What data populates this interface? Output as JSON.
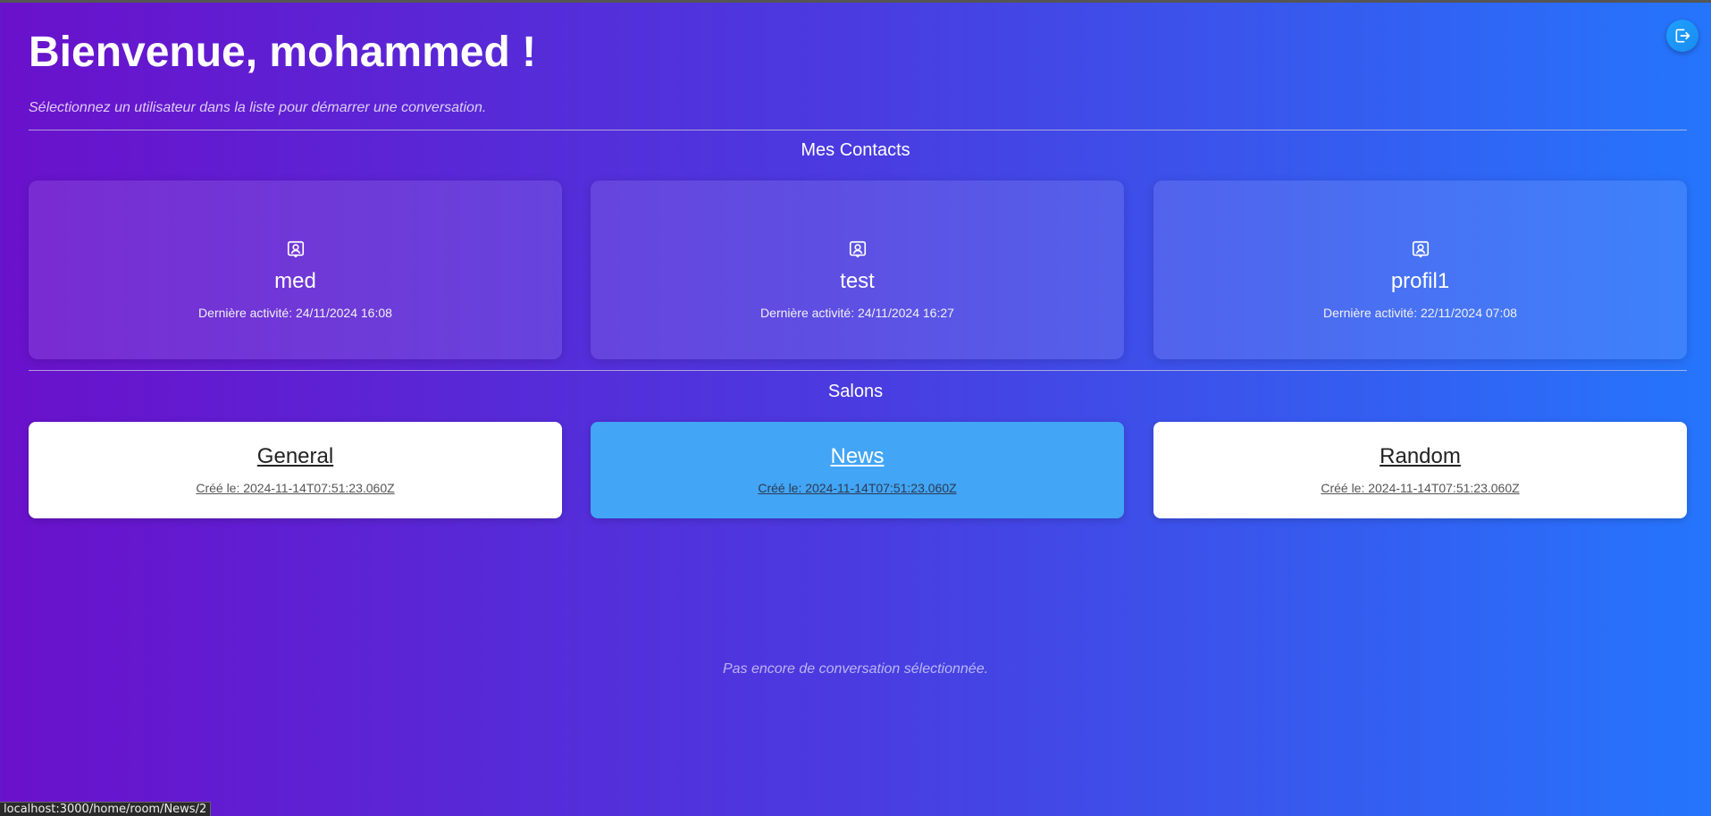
{
  "header": {
    "title": "Bienvenue, mohammed !",
    "subtitle": "Sélectionnez un utilisateur dans la liste pour démarrer une conversation.",
    "logout_icon": "logout-icon"
  },
  "contacts": {
    "title": "Mes Contacts",
    "items": [
      {
        "name": "med",
        "last_activity": "Dernière activité: 24/11/2024 16:08",
        "icon": "user-badge-icon"
      },
      {
        "name": "test",
        "last_activity": "Dernière activité: 24/11/2024 16:27",
        "icon": "user-badge-icon"
      },
      {
        "name": "profil1",
        "last_activity": "Dernière activité: 22/11/2024 07:08",
        "icon": "user-badge-icon"
      }
    ]
  },
  "rooms": {
    "title": "Salons",
    "items": [
      {
        "name": "General",
        "created": "Créé le: 2024-11-14T07:51:23.060Z",
        "highlighted": false
      },
      {
        "name": "News",
        "created": "Créé le: 2024-11-14T07:51:23.060Z",
        "highlighted": true
      },
      {
        "name": "Random",
        "created": "Créé le: 2024-11-14T07:51:23.060Z",
        "highlighted": false
      }
    ]
  },
  "conversation": {
    "empty_message": "Pas encore de conversation sélectionnée."
  },
  "status_bar": {
    "url": "localhost:3000/home/room/News/2"
  },
  "colors": {
    "gradient_start": "#6a11cb",
    "gradient_end": "#2575fc",
    "room_highlight": "#42a5f5",
    "logout_button": "#1ea0ff"
  }
}
